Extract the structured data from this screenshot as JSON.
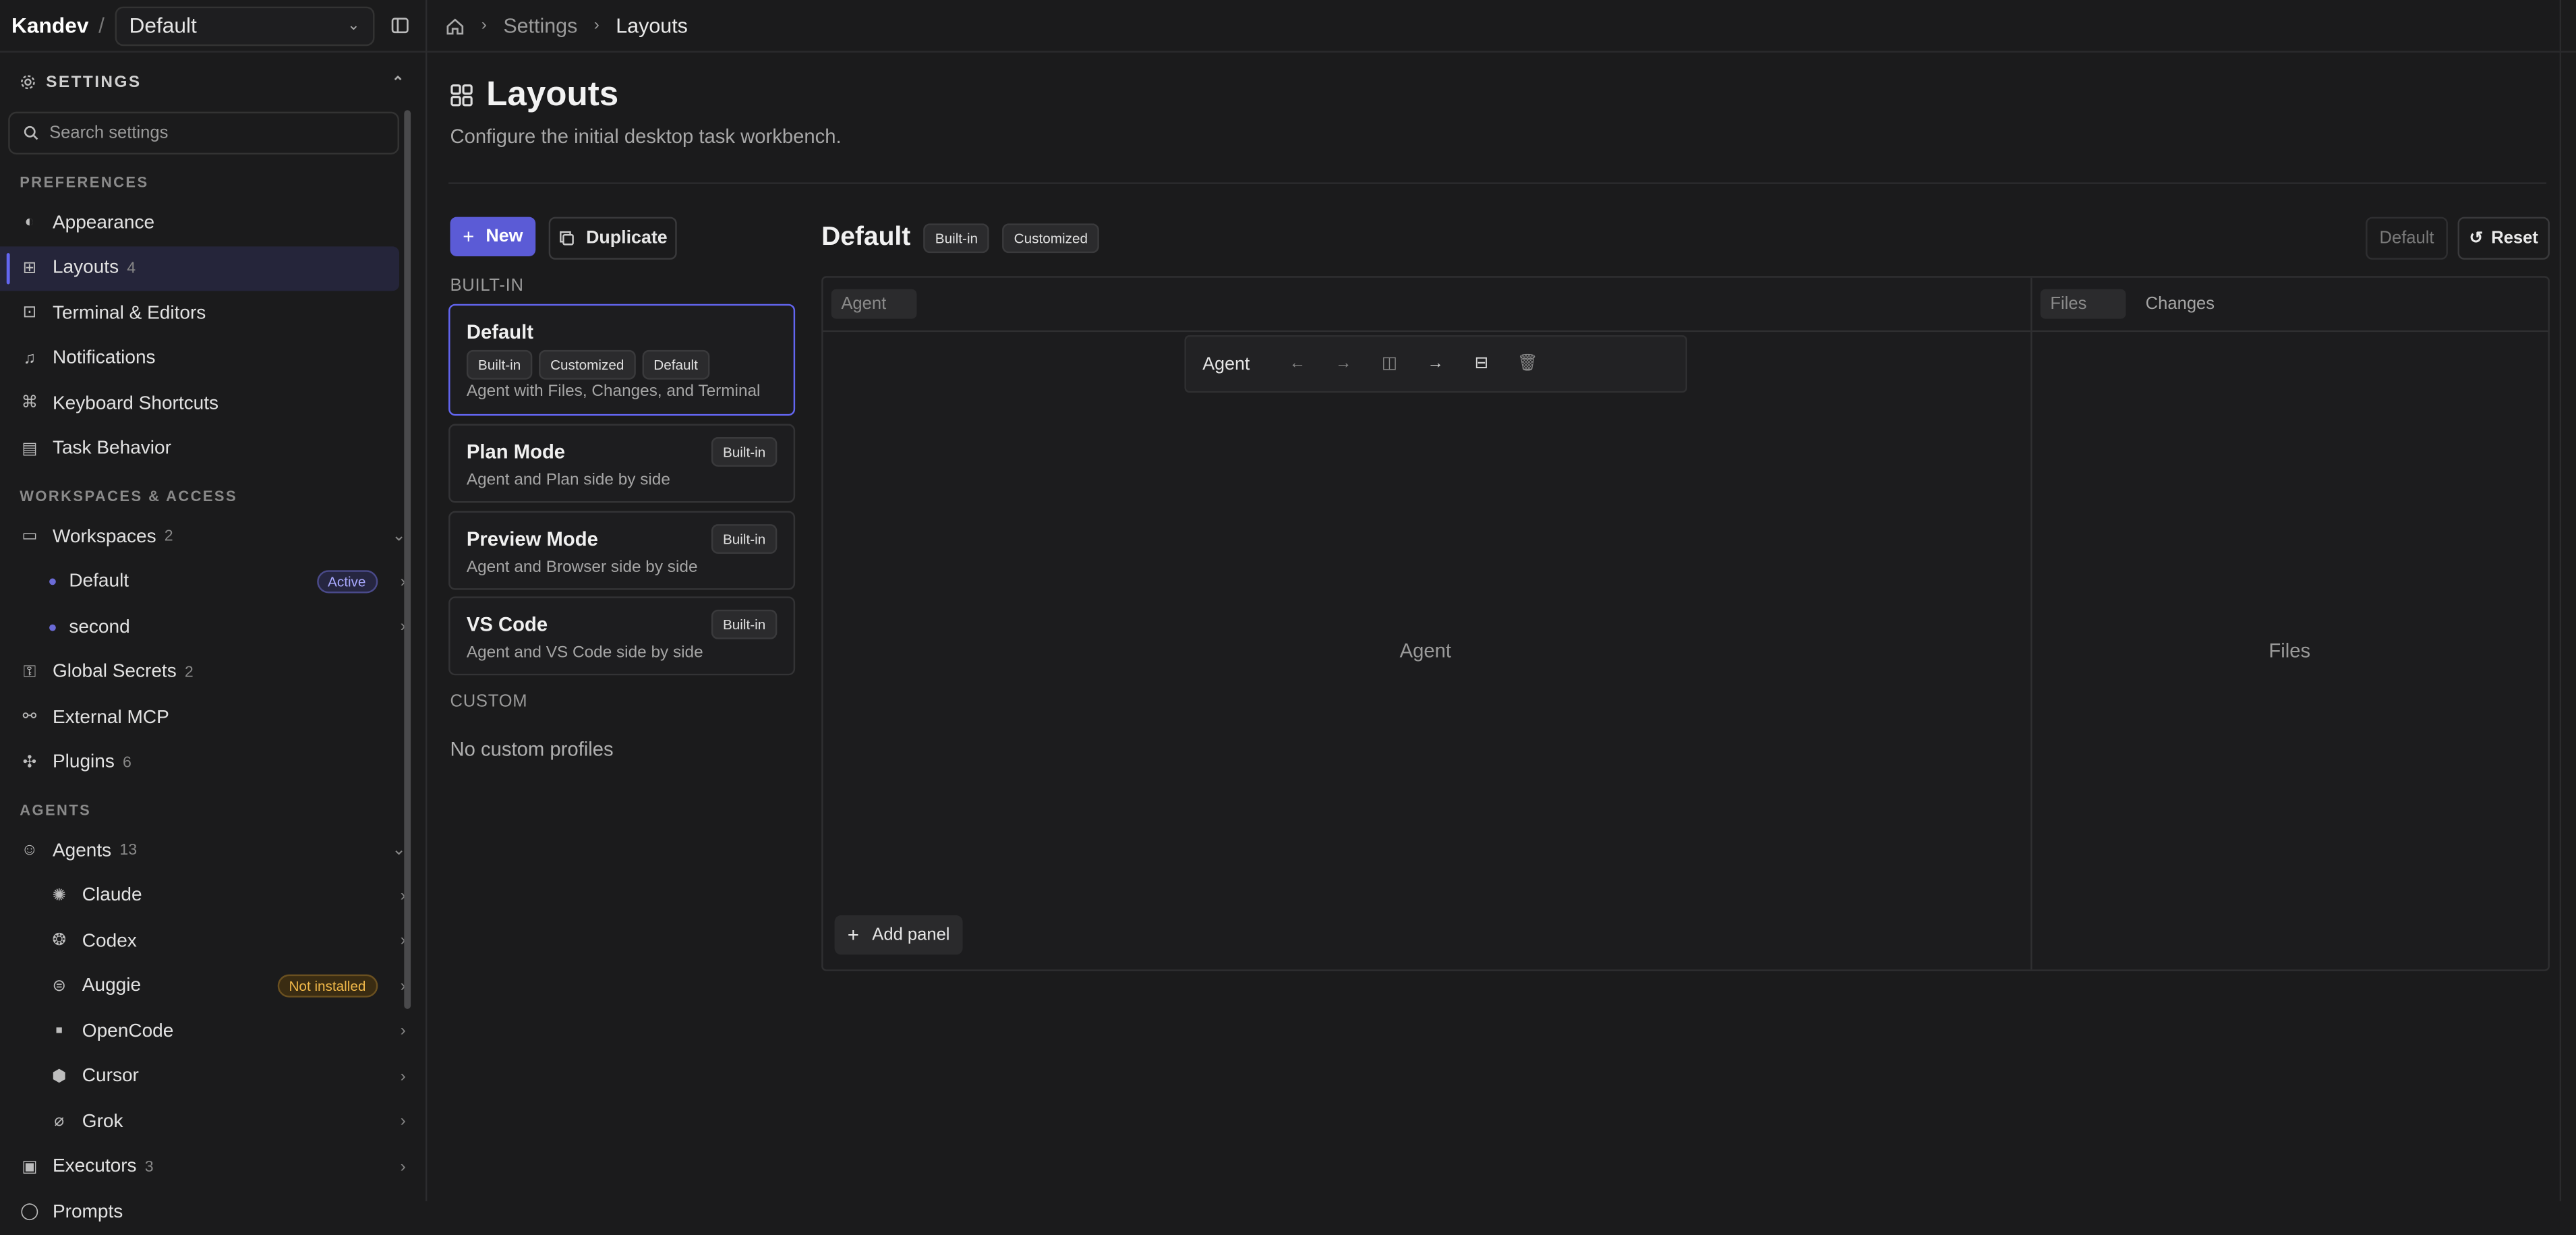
{
  "app": {
    "brand": "Kandev",
    "workspace_select": "Default"
  },
  "sidebar": {
    "section_title": "SETTINGS",
    "search_placeholder": "Search settings",
    "groups": {
      "preferences": "PREFERENCES",
      "workspaces_access": "WORKSPACES & ACCESS",
      "agents": "AGENTS"
    },
    "items": {
      "appearance": "Appearance",
      "layouts": "Layouts",
      "layouts_count": "4",
      "terminal": "Terminal & Editors",
      "notifications": "Notifications",
      "shortcuts": "Keyboard Shortcuts",
      "task_behavior": "Task Behavior",
      "workspaces": "Workspaces",
      "workspaces_count": "2",
      "ws_default": "Default",
      "ws_default_badge": "Active",
      "ws_second": "second",
      "global_secrets": "Global Secrets",
      "global_secrets_count": "2",
      "external_mcp": "External MCP",
      "plugins": "Plugins",
      "plugins_count": "6",
      "agents": "Agents",
      "agents_count": "13",
      "claude": "Claude",
      "codex": "Codex",
      "auggie": "Auggie",
      "auggie_badge": "Not installed",
      "opencode": "OpenCode",
      "cursor": "Cursor",
      "grok": "Grok",
      "executors": "Executors",
      "executors_count": "3",
      "prompts": "Prompts"
    }
  },
  "breadcrumb": {
    "settings": "Settings",
    "current": "Layouts"
  },
  "page": {
    "title": "Layouts",
    "subtitle": "Configure the initial desktop task workbench."
  },
  "actions": {
    "new": "New",
    "duplicate": "Duplicate"
  },
  "profiles": {
    "builtin_label": "BUILT-IN",
    "custom_label": "CUSTOM",
    "custom_empty": "No custom profiles",
    "default": {
      "name": "Default",
      "pills": [
        "Built-in",
        "Customized",
        "Default"
      ],
      "desc": "Agent with Files, Changes, and Terminal"
    },
    "plan": {
      "name": "Plan Mode",
      "pill": "Built-in",
      "desc": "Agent and Plan side by side"
    },
    "preview": {
      "name": "Preview Mode",
      "pill": "Built-in",
      "desc": "Agent and Browser side by side"
    },
    "vscode": {
      "name": "VS Code",
      "pill": "Built-in",
      "desc": "Agent and VS Code side by side"
    }
  },
  "editor": {
    "title": "Default",
    "pill_builtin": "Built-in",
    "pill_customized": "Customized",
    "btn_default": "Default",
    "btn_reset": "Reset",
    "left_tab": "Agent",
    "toolbar_label": "Agent",
    "left_center": "Agent",
    "right_tab_files": "Files",
    "right_tab_changes": "Changes",
    "right_center": "Files",
    "add_panel": "Add panel"
  }
}
